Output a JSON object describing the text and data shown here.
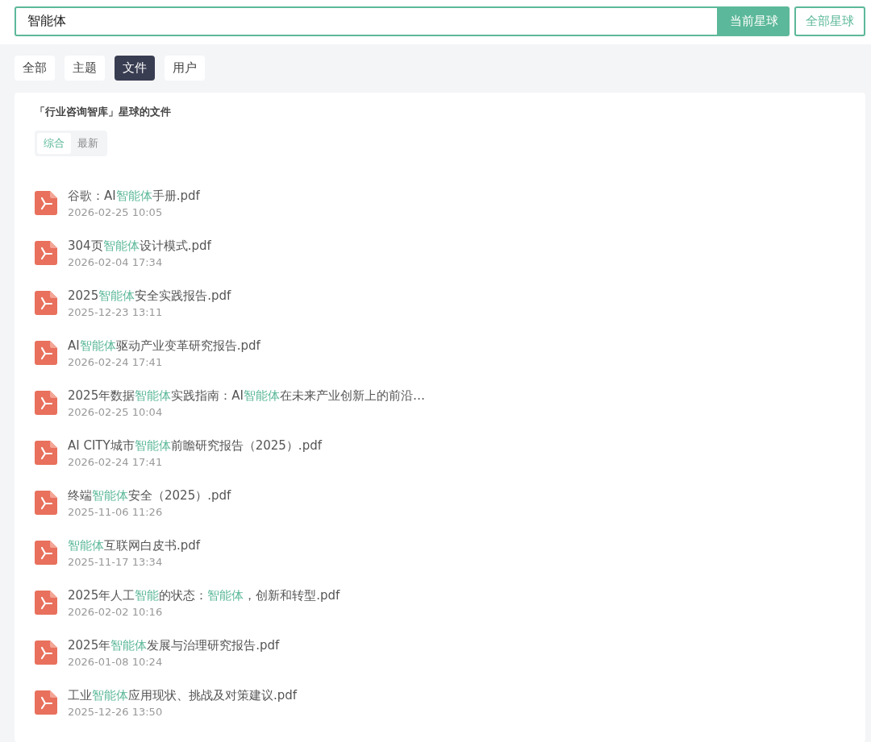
{
  "search": {
    "value": "智能体",
    "buttons": [
      {
        "label": "当前星球",
        "selected": true
      },
      {
        "label": "全部星球",
        "selected": false
      }
    ]
  },
  "tabs": [
    {
      "label": "全部",
      "selected": false
    },
    {
      "label": "主题",
      "selected": false
    },
    {
      "label": "文件",
      "selected": true
    },
    {
      "label": "用户",
      "selected": false
    }
  ],
  "panel": {
    "title": "「行业咨询智库」星球的文件",
    "sort_tabs": [
      {
        "label": "综合",
        "selected": true
      },
      {
        "label": "最新",
        "selected": false
      }
    ],
    "files": [
      {
        "title": [
          {
            "text": "谷歌：AI",
            "highlight": false
          },
          {
            "text": "智能体",
            "highlight": true
          },
          {
            "text": "手册.pdf",
            "highlight": false
          }
        ],
        "date": "2026-02-25 10:05"
      },
      {
        "title": [
          {
            "text": "304页",
            "highlight": false
          },
          {
            "text": "智能体",
            "highlight": true
          },
          {
            "text": "设计模式.pdf",
            "highlight": false
          }
        ],
        "date": "2026-02-04 17:34"
      },
      {
        "title": [
          {
            "text": "2025",
            "highlight": false
          },
          {
            "text": "智能体",
            "highlight": true
          },
          {
            "text": "安全实践报告.pdf",
            "highlight": false
          }
        ],
        "date": "2025-12-23 13:11"
      },
      {
        "title": [
          {
            "text": "AI",
            "highlight": false
          },
          {
            "text": "智能体",
            "highlight": true
          },
          {
            "text": "驱动产业变革研究报告.pdf",
            "highlight": false
          }
        ],
        "date": "2026-02-24 17:41"
      },
      {
        "title": [
          {
            "text": "2025年数据",
            "highlight": false
          },
          {
            "text": "智能体",
            "highlight": true
          },
          {
            "text": "实践指南：AI",
            "highlight": false
          },
          {
            "text": "智能体",
            "highlight": true
          },
          {
            "text": "在未来产业创新上的前沿…",
            "highlight": false
          }
        ],
        "date": "2026-02-25 10:04"
      },
      {
        "title": [
          {
            "text": "AI CITY城市",
            "highlight": false
          },
          {
            "text": "智能体",
            "highlight": true
          },
          {
            "text": "前瞻研究报告（2025）.pdf",
            "highlight": false
          }
        ],
        "date": "2026-02-24 17:41"
      },
      {
        "title": [
          {
            "text": "终端",
            "highlight": false
          },
          {
            "text": "智能体",
            "highlight": true
          },
          {
            "text": "安全（2025）.pdf",
            "highlight": false
          }
        ],
        "date": "2025-11-06 11:26"
      },
      {
        "title": [
          {
            "text": "智能体",
            "highlight": true
          },
          {
            "text": "互联网白皮书.pdf",
            "highlight": false
          }
        ],
        "date": "2025-11-17 13:34"
      },
      {
        "title": [
          {
            "text": "2025年人工",
            "highlight": false
          },
          {
            "text": "智能",
            "highlight": true
          },
          {
            "text": "的状态：",
            "highlight": false
          },
          {
            "text": "智能体",
            "highlight": true
          },
          {
            "text": "，创新和转型.pdf",
            "highlight": false
          }
        ],
        "date": "2026-02-02 10:16"
      },
      {
        "title": [
          {
            "text": "2025年",
            "highlight": false
          },
          {
            "text": "智能体",
            "highlight": true
          },
          {
            "text": "发展与治理研究报告.pdf",
            "highlight": false
          }
        ],
        "date": "2026-01-08 10:24"
      },
      {
        "title": [
          {
            "text": "工业",
            "highlight": false
          },
          {
            "text": "智能体",
            "highlight": true
          },
          {
            "text": "应用现状、挑战及对策建议.pdf",
            "highlight": false
          }
        ],
        "date": "2025-12-26 13:50"
      }
    ]
  }
}
